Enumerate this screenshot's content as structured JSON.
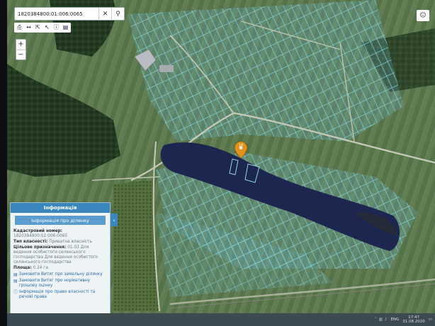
{
  "search": {
    "value": "1820384800:01:006:0065",
    "clear_icon": "close-icon",
    "search_icon": "search-icon"
  },
  "toolbar": {
    "tools": [
      {
        "icon": "print-icon",
        "glyph": "⎙"
      },
      {
        "icon": "measure-icon",
        "glyph": "↔"
      },
      {
        "icon": "export-icon",
        "glyph": "⇱"
      },
      {
        "icon": "cursor-icon",
        "glyph": "↖"
      },
      {
        "icon": "info-icon",
        "glyph": "ⓘ"
      },
      {
        "icon": "document-icon",
        "glyph": "▤"
      }
    ]
  },
  "zoom": {
    "plus": "+",
    "minus": "−"
  },
  "user": {
    "icon": "user-icon",
    "glyph": "☺"
  },
  "map": {
    "pin_label": "18",
    "colors": {
      "water": "#1f2a55",
      "parcel": "#7fd6e0",
      "road": "#dfe6d6"
    }
  },
  "panel": {
    "title": "Інформація",
    "subtitle": "Інформація про ділянку",
    "fields": [
      {
        "label": "Кадастровий номер:",
        "value": "1820384800:01:006:0065"
      },
      {
        "label": "Тип власності:",
        "value": "Приватна власність"
      },
      {
        "label": "Цільове призначення:",
        "value": "01.03 Для ведення особистого селянського господарства Для ведення особистого селянського господарства"
      },
      {
        "label": "Площа:",
        "value": "0.24 га"
      }
    ],
    "links": [
      {
        "icon": "document-icon",
        "text": "Замовити Витяг про земельну ділянку"
      },
      {
        "icon": "document-icon",
        "text": "Замовити Витяг про нормативну грошову оцінку"
      },
      {
        "icon": "info-icon",
        "text": "Інформація про право власності та речові права"
      }
    ],
    "collapse_glyph": "‹"
  },
  "taskbar": {
    "lang": "ENG",
    "time": "17:47",
    "date": "31.08.2020"
  }
}
